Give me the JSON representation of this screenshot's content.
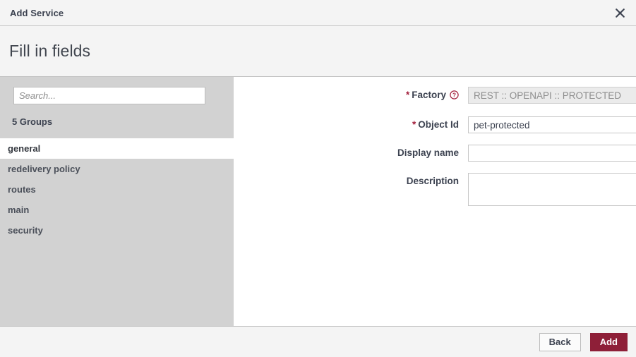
{
  "window": {
    "title": "Add Service",
    "close_icon": "close-icon"
  },
  "header": {
    "title": "Fill in fields"
  },
  "sidebar": {
    "search": {
      "value": "",
      "placeholder": "Search..."
    },
    "groups_count_label": "5 Groups",
    "items": [
      {
        "label": "general",
        "selected": true
      },
      {
        "label": "redelivery policy",
        "selected": false
      },
      {
        "label": "routes",
        "selected": false
      },
      {
        "label": "main",
        "selected": false
      },
      {
        "label": "security",
        "selected": false
      }
    ]
  },
  "form": {
    "fields": [
      {
        "label": "Factory",
        "required": true,
        "help_icon": "help-circle-icon",
        "value": "REST :: OPENAPI :: PROTECTED",
        "placeholder": "",
        "disabled": true,
        "type": "text"
      },
      {
        "label": "Object Id",
        "required": true,
        "value": "pet-protected",
        "placeholder": "",
        "disabled": false,
        "type": "text"
      },
      {
        "label": "Display name",
        "required": false,
        "value": "",
        "placeholder": "",
        "disabled": false,
        "type": "text"
      },
      {
        "label": "Description",
        "required": false,
        "value": "",
        "placeholder": "",
        "disabled": false,
        "type": "textarea"
      }
    ]
  },
  "footer": {
    "back_label": "Back",
    "add_label": "Add"
  },
  "colors": {
    "accent": "#8e1f38",
    "required_star": "#a3203c",
    "header_bg": "#f4f4f4",
    "sidebar_bg": "#d2d2d2",
    "disabled_input_bg": "#ebebeb"
  }
}
